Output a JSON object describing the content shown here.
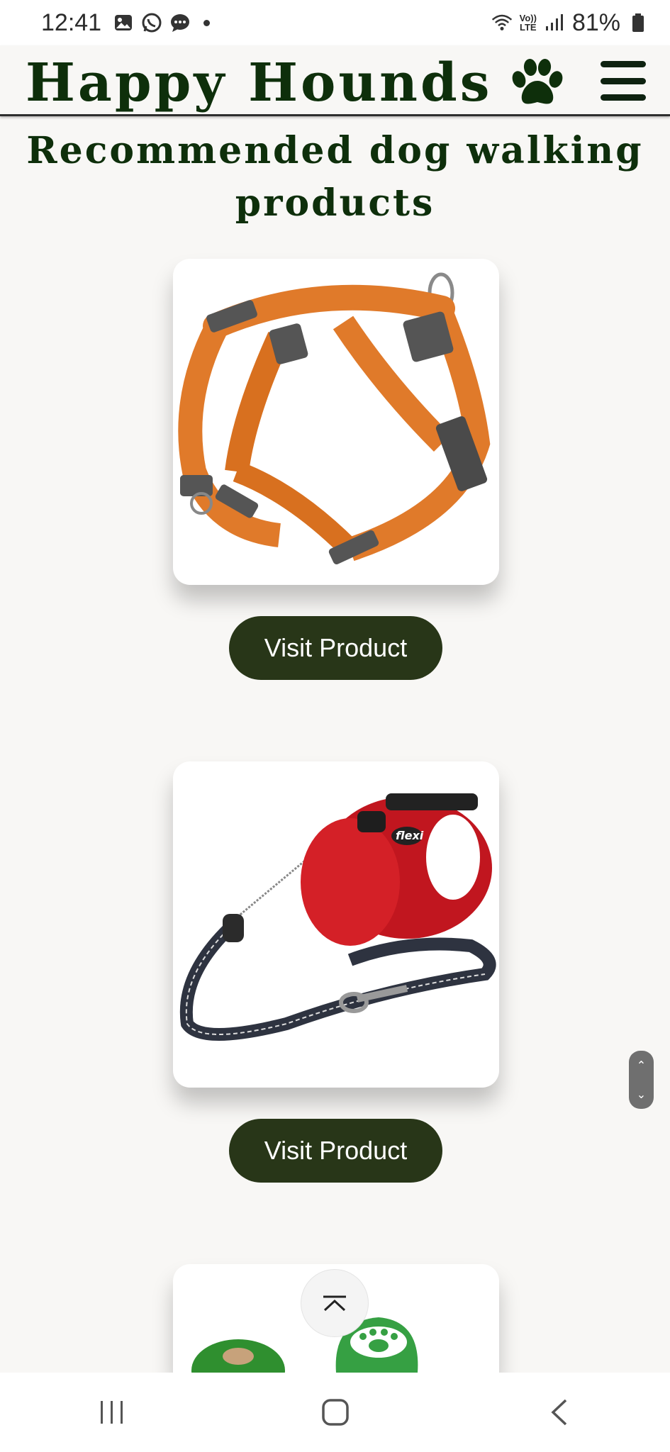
{
  "status_bar": {
    "time": "12:41",
    "lte_top": "Vo))",
    "lte_bottom": "LTE",
    "battery": "81%"
  },
  "header": {
    "brand": "Happy Hounds",
    "brand_icon": "paw-icon",
    "menu_icon": "hamburger-menu-icon",
    "brand_color": "#0e2f0b"
  },
  "page": {
    "title": "Recommended dog walking products"
  },
  "products": [
    {
      "image": "orange-dog-harness",
      "button_label": "Visit Product"
    },
    {
      "image": "red-retractable-leash",
      "button_label": "Visit Product"
    },
    {
      "image": "green-poop-bags"
    }
  ],
  "colors": {
    "button_bg": "#283618",
    "background": "#f8f7f5"
  }
}
